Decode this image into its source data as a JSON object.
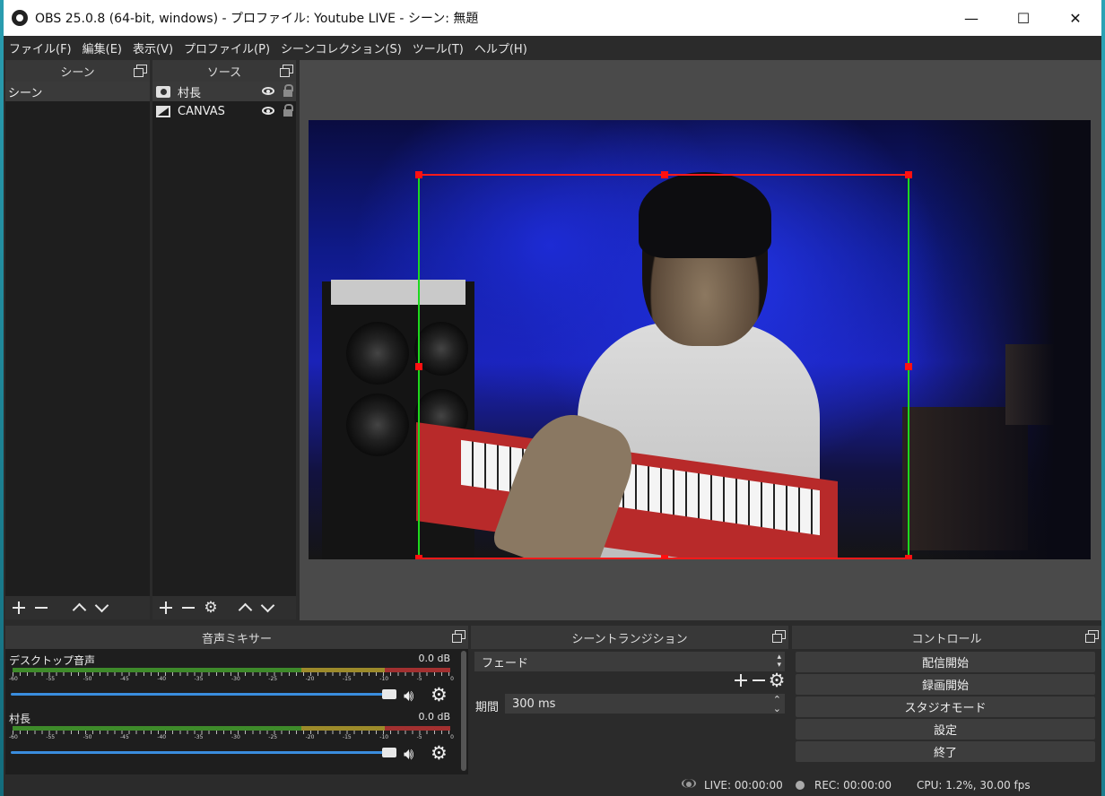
{
  "window": {
    "title": "OBS 25.0.8 (64-bit, windows) - プロファイル: Youtube LIVE - シーン: 無題",
    "minimize": "—",
    "maximize": "☐",
    "close": "✕"
  },
  "menu": [
    "ファイル(F)",
    "編集(E)",
    "表示(V)",
    "プロファイル(P)",
    "シーンコレクション(S)",
    "ツール(T)",
    "ヘルプ(H)"
  ],
  "scenes": {
    "title": "シーン",
    "items": [
      "シーン"
    ]
  },
  "sources": {
    "title": "ソース",
    "items": [
      {
        "name": "村長",
        "icon": "camera-icon"
      },
      {
        "name": "CANVAS",
        "icon": "image-icon"
      }
    ]
  },
  "mixer": {
    "title": "音声ミキサー",
    "scale": [
      "-60",
      "-55",
      "-50",
      "-45",
      "-40",
      "-35",
      "-30",
      "-25",
      "-20",
      "-15",
      "-10",
      "-5",
      "0"
    ],
    "channels": [
      {
        "name": "デスクトップ音声",
        "db": "0.0 dB",
        "volume": 1.0
      },
      {
        "name": "村長",
        "db": "0.0 dB",
        "volume": 1.0
      }
    ]
  },
  "transitions": {
    "title": "シーントランジション",
    "selected": "フェード",
    "duration_label": "期間",
    "duration_value": "300 ms"
  },
  "controls": {
    "title": "コントロール",
    "buttons": [
      "配信開始",
      "録画開始",
      "スタジオモード",
      "設定",
      "終了"
    ]
  },
  "status": {
    "live": "LIVE: 00:00:00",
    "rec": "REC: 00:00:00",
    "cpu": "CPU: 1.2%, 30.00 fps"
  },
  "colors": {
    "selection_border_sides": "#1ed91e",
    "selection_border_top_bottom": "#ff1a1a",
    "volume_slider": "#3a8dde"
  }
}
